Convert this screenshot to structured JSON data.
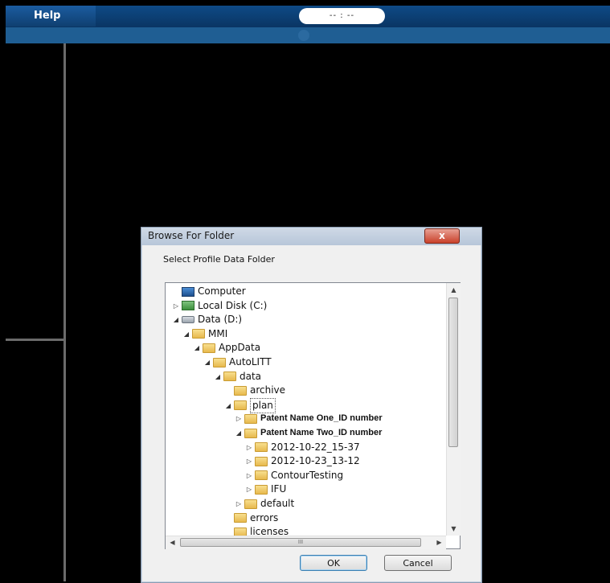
{
  "topbar": {
    "help_label": "Help",
    "time_display": "-- : --"
  },
  "dialog": {
    "title": "Browse For Folder",
    "close_label": "x",
    "prompt": "Select Profile Data Folder",
    "tree": [
      {
        "label": "Computer",
        "icon": "computer-icon",
        "arrow": "",
        "level": 0
      },
      {
        "label": "Local Disk (C:)",
        "icon": "local-disk-icon",
        "arrow": "▷",
        "level": 0
      },
      {
        "label": "Data (D:)",
        "icon": "drive-icon",
        "arrow": "◢",
        "level": 0
      },
      {
        "label": "MMI",
        "icon": "folder-icon",
        "arrow": "◢",
        "level": 1
      },
      {
        "label": "AppData",
        "icon": "folder-icon",
        "arrow": "◢",
        "level": 2
      },
      {
        "label": "AutoLITT",
        "icon": "folder-icon",
        "arrow": "◢",
        "level": 3
      },
      {
        "label": "data",
        "icon": "folder-icon",
        "arrow": "◢",
        "level": 4
      },
      {
        "label": "archive",
        "icon": "folder-icon",
        "arrow": "",
        "level": 5
      },
      {
        "label": "plan",
        "icon": "folder-icon",
        "arrow": "◢",
        "level": 5,
        "selected": true
      },
      {
        "label": "Patent Name One_ID number",
        "icon": "folder-icon",
        "arrow": "▷",
        "level": 6,
        "bold": true
      },
      {
        "label": "Patent Name Two_ID number",
        "icon": "folder-icon",
        "arrow": "◢",
        "level": 6,
        "bold": true
      },
      {
        "label": "2012-10-22_15-37",
        "icon": "folder-icon",
        "arrow": "▷",
        "level": 7
      },
      {
        "label": "2012-10-23_13-12",
        "icon": "folder-icon",
        "arrow": "▷",
        "level": 7
      },
      {
        "label": "ContourTesting",
        "icon": "folder-icon",
        "arrow": "▷",
        "level": 7
      },
      {
        "label": "IFU",
        "icon": "folder-icon",
        "arrow": "▷",
        "level": 7
      },
      {
        "label": "default",
        "icon": "folder-icon",
        "arrow": "▷",
        "level": 6
      },
      {
        "label": "errors",
        "icon": "folder-icon",
        "arrow": "",
        "level": 5
      },
      {
        "label": "licenses",
        "icon": "folder-icon",
        "arrow": "",
        "level": 5
      }
    ],
    "hscroll_grip": "III",
    "ok_label": "OK",
    "cancel_label": "Cancel"
  }
}
